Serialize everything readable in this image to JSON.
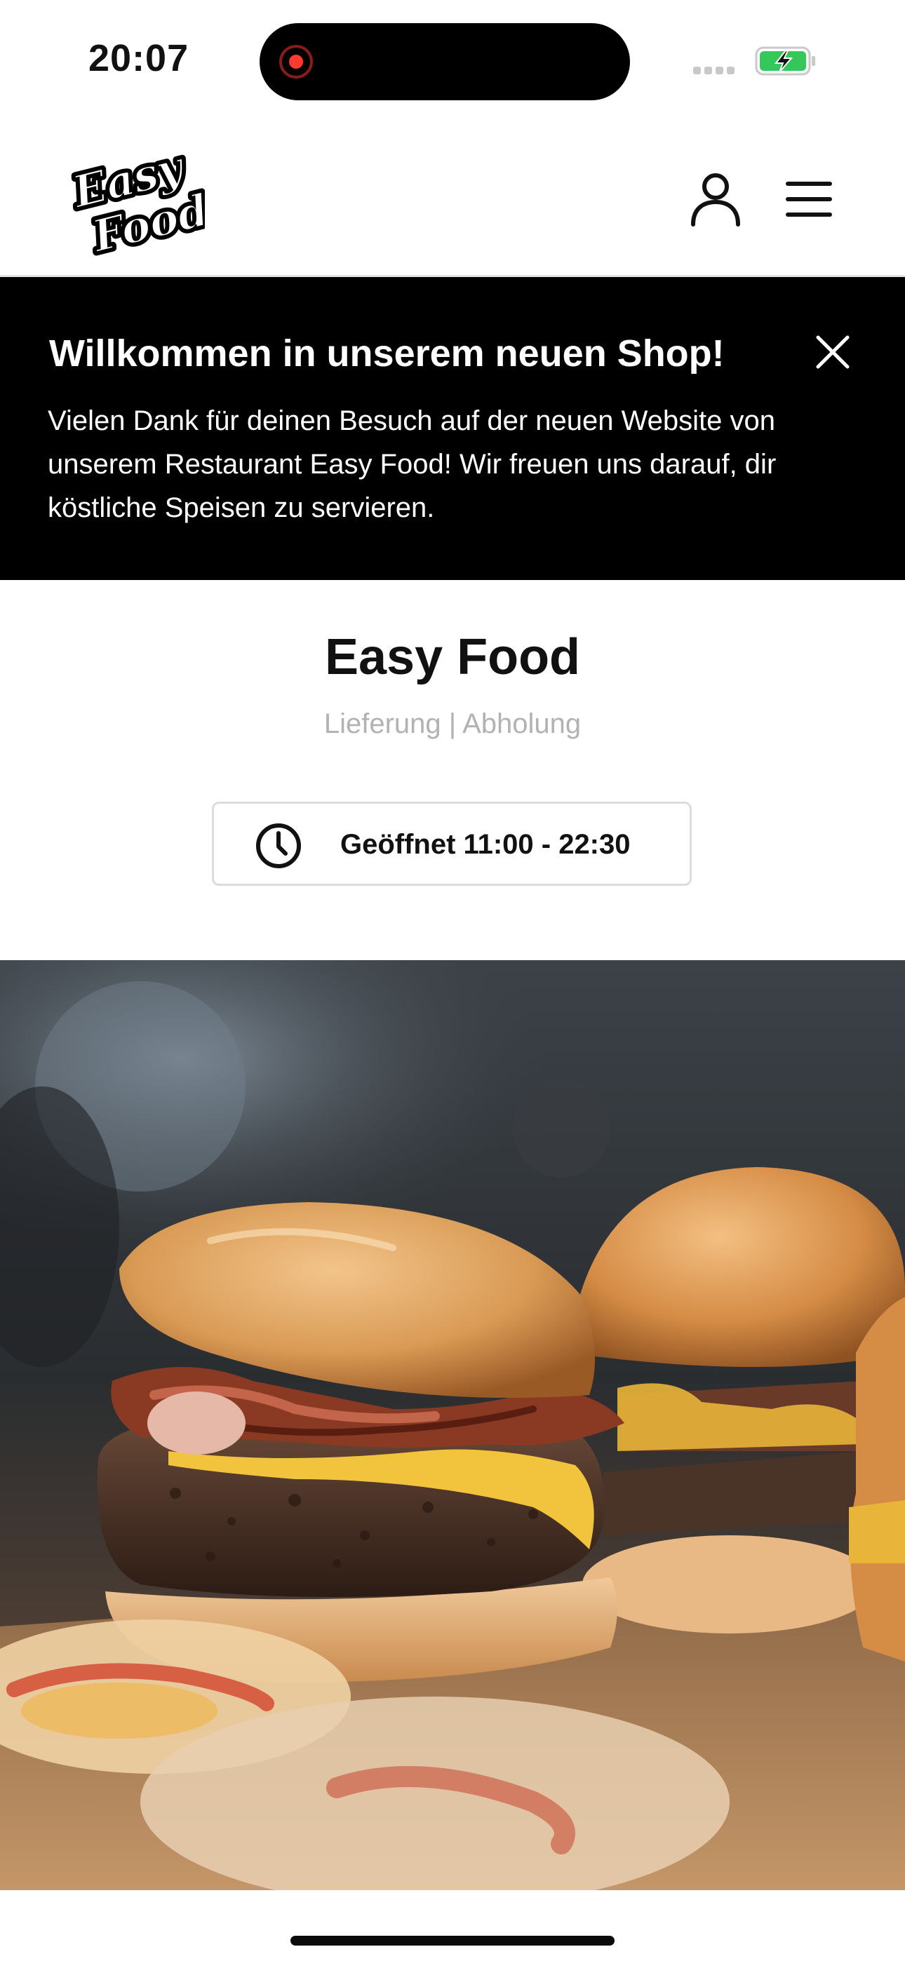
{
  "status_bar": {
    "time": "20:07"
  },
  "header": {
    "logo_text_line1": "Easy",
    "logo_text_line2": "Food",
    "account_icon": "user-icon",
    "menu_icon": "hamburger-menu-icon"
  },
  "banner": {
    "title": "Willkommen in unserem neuen Shop!",
    "text": "Vielen Dank für deinen Besuch auf der neuen Website von unserem Restaurant Easy Food! Wir freuen uns darauf, dir köstliche Speisen zu servieren.",
    "close_icon": "close-icon"
  },
  "restaurant": {
    "name": "Easy Food",
    "service_modes": "Lieferung | Abholung",
    "hours": "Geöffnet 11:00 - 22:30"
  },
  "colors": {
    "banner_bg": "#000000",
    "text_primary": "#111111",
    "text_muted": "#b2b2b2",
    "border": "#dcdcdc",
    "battery_green": "#34c759",
    "record_red": "#ff3b30"
  }
}
